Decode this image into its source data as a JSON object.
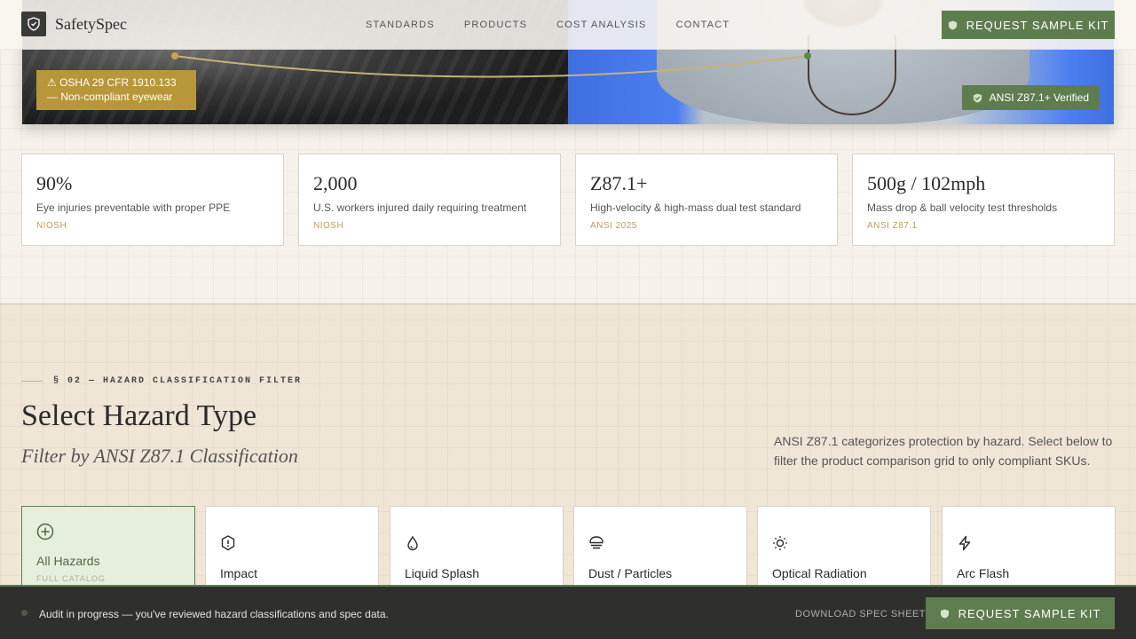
{
  "brand": {
    "name": "SafetySpec"
  },
  "nav": {
    "links": [
      "STANDARDS",
      "PRODUCTS",
      "COST ANALYSIS",
      "CONTACT"
    ],
    "cta": "REQUEST SAMPLE KIT"
  },
  "hero": {
    "hazard_tag_line1": "⚠ OSHA 29 CFR 1910.133",
    "hazard_tag_line2": "— Non-compliant eyewear",
    "verified_tag": "ANSI Z87.1+ Verified"
  },
  "stats": [
    {
      "value": "90%",
      "label": "Eye injuries preventable with proper PPE",
      "source": "NIOSH"
    },
    {
      "value": "2,000",
      "label": "U.S. workers injured daily requiring treatment",
      "source": "NIOSH"
    },
    {
      "value": "Z87.1+",
      "label": "High-velocity & high-mass dual test standard",
      "source": "ANSI 2025"
    },
    {
      "value": "500g / 102mph",
      "label": "Mass drop & ball velocity test thresholds",
      "source": "ANSI Z87.1"
    }
  ],
  "hazard_section": {
    "eyebrow": "§ 02 — HAZARD CLASSIFICATION FILTER",
    "title": "Select Hazard Type",
    "subtitle": "Filter by ANSI Z87.1 Classification",
    "description": "ANSI Z87.1 categorizes protection by hazard. Select below to filter the product comparison grid to only compliant SKUs.",
    "cards": [
      {
        "label": "All Hazards",
        "sub": "FULL CATALOG",
        "icon": "plus-circle-icon",
        "active": true
      },
      {
        "label": "Impact",
        "icon": "alert-shield-icon"
      },
      {
        "label": "Liquid Splash",
        "icon": "droplet-icon"
      },
      {
        "label": "Dust / Particles",
        "icon": "dust-icon"
      },
      {
        "label": "Optical Radiation",
        "icon": "sun-icon"
      },
      {
        "label": "Arc Flash",
        "icon": "lightning-icon"
      }
    ]
  },
  "bottom_bar": {
    "audit_text": "Audit in progress — you've reviewed hazard classifications and spec data.",
    "download": "DOWNLOAD SPEC SHEET",
    "cta": "REQUEST SAMPLE KIT"
  },
  "colors": {
    "accent_green": "#5e7d4f",
    "accent_gold": "#b8963a",
    "dark": "#2f302d"
  }
}
